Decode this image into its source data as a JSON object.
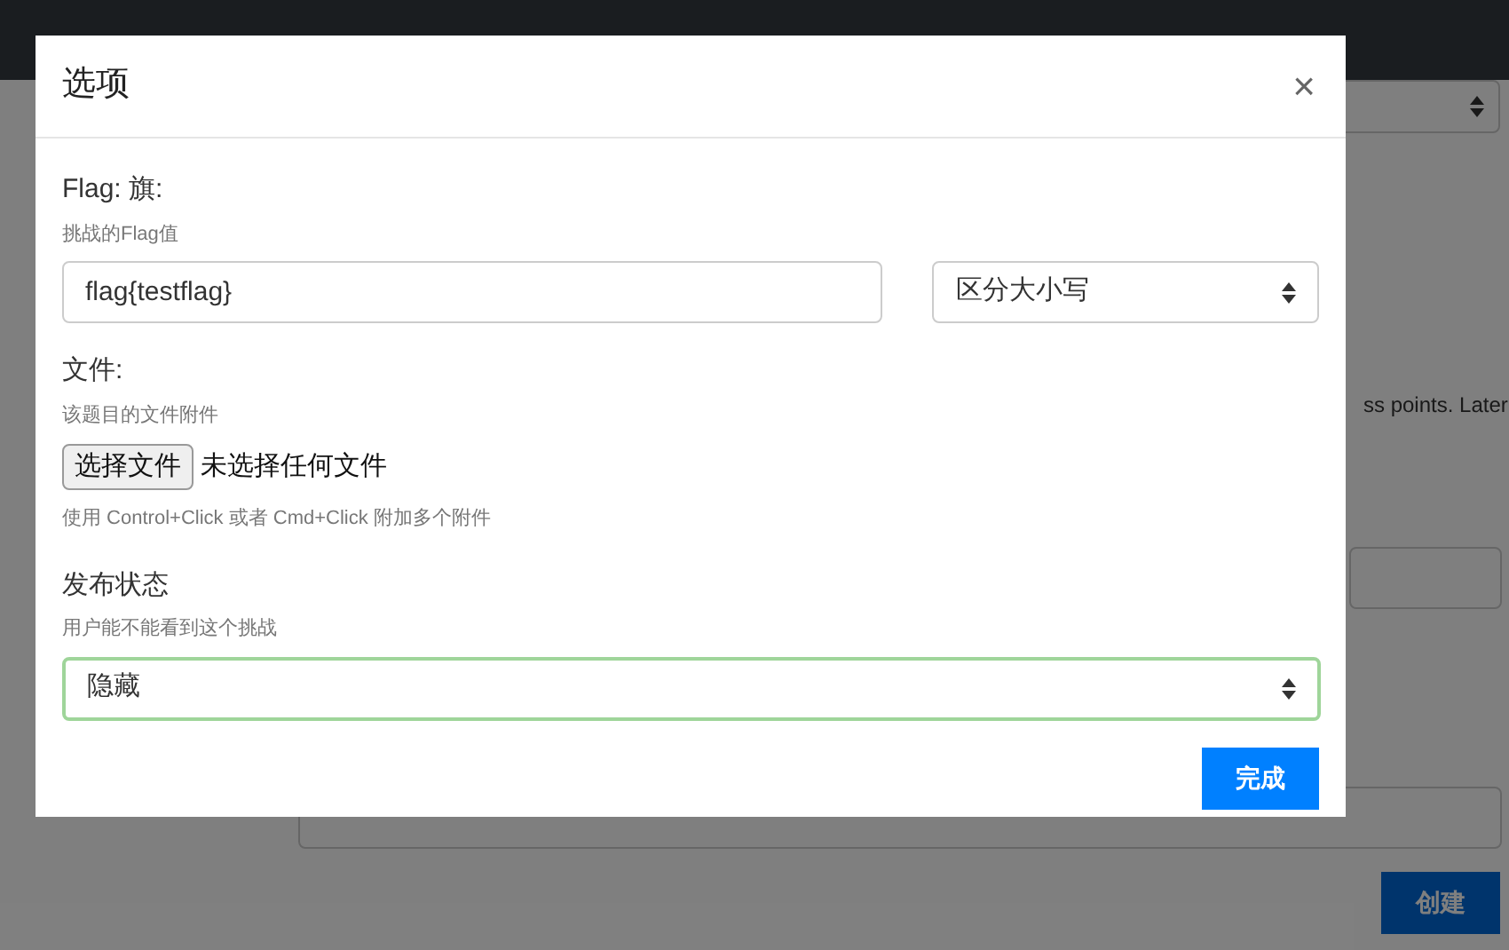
{
  "background": {
    "hint_text": "ss points. Later",
    "create_button": "创建"
  },
  "modal": {
    "title": "选项",
    "close": "×",
    "flag": {
      "label": "Flag: 旗:",
      "hint": "挑战的Flag值",
      "value": "flag{testflag}",
      "case_select": "区分大小写"
    },
    "files": {
      "label": "文件:",
      "hint": "该题目的文件附件",
      "choose_button": "选择文件",
      "no_file": "未选择任何文件",
      "help": "使用 Control+Click 或者 Cmd+Click 附加多个附件"
    },
    "state": {
      "label": "发布状态",
      "hint": "用户能不能看到这个挑战",
      "value": "隐藏",
      "focused": true
    },
    "done_button": "完成"
  }
}
